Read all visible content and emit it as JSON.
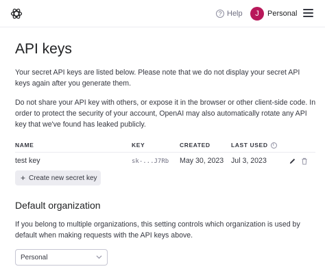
{
  "header": {
    "help_label": "Help",
    "account_initial": "J",
    "account_label": "Personal"
  },
  "page": {
    "title": "API keys",
    "intro": "Your secret API keys are listed below. Please note that we do not display your secret API keys again after you generate them.",
    "warning": "Do not share your API key with others, or expose it in the browser or other client-side code. In order to protect the security of your account, OpenAI may also automatically rotate any API key that we've found has leaked publicly."
  },
  "table": {
    "columns": [
      "NAME",
      "KEY",
      "CREATED",
      "LAST USED"
    ],
    "rows": [
      {
        "name": "test key",
        "key": "sk-...J7Rb",
        "created": "May 30, 2023",
        "last_used": "Jul 3, 2023"
      }
    ],
    "create_button": "Create new secret key"
  },
  "default_org": {
    "heading": "Default organization",
    "description": "If you belong to multiple organizations, this setting controls which organization is used by default when making requests with the API keys above.",
    "selected": "Personal"
  },
  "colors": {
    "avatar": "#b8185a",
    "text": "#202123",
    "muted": "#6e6e80",
    "button_bg": "#ececf1"
  },
  "icons": [
    "openai-logo-icon",
    "help-icon",
    "menu-icon",
    "info-icon",
    "edit-icon",
    "trash-icon",
    "plus-icon",
    "chevron-down-icon"
  ]
}
